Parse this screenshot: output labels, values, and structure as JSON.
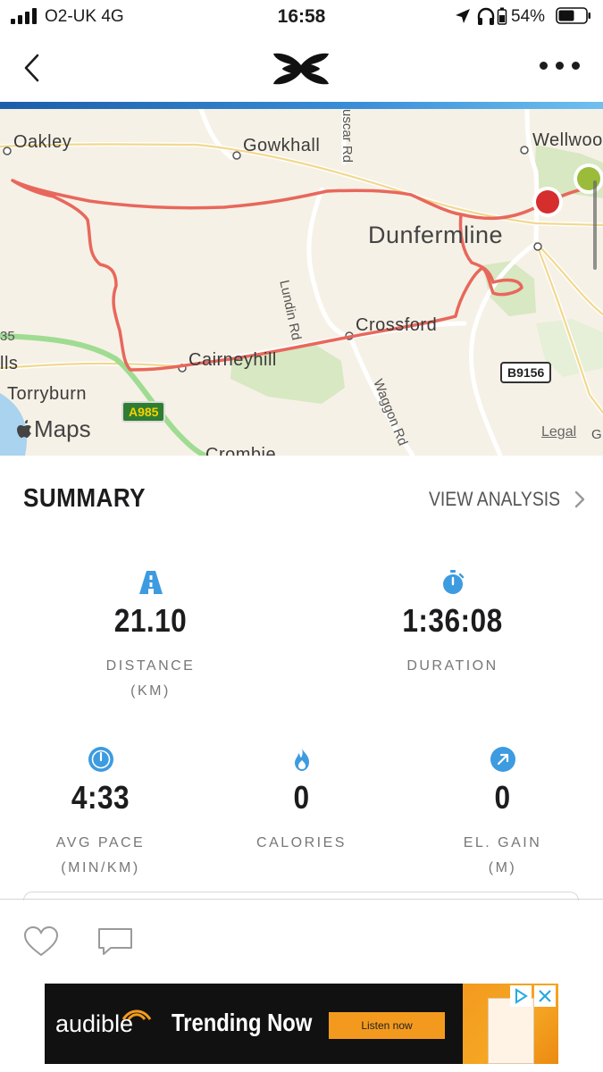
{
  "status_bar": {
    "carrier": "O2-UK  4G",
    "time": "16:58",
    "battery": "54%"
  },
  "header": {
    "back_icon": "chevron-left-icon",
    "logo": "under-armour-logo",
    "more_icon": "ellipsis-icon"
  },
  "map": {
    "places": {
      "oakley": "Oakley",
      "gowkhall": "Gowkhall",
      "wellwood": "Wellwoo",
      "dunfermline": "Dunfermline",
      "crossford": "Crossford",
      "cairneyhill": "Cairneyhill",
      "torryburn": "Torryburn",
      "lls": "lls",
      "num35": "35",
      "crombie": "Crombie",
      "edge_g": "G"
    },
    "roads": {
      "lundin": "Lundin Rd",
      "waggon": "Waggon Rd",
      "muscar": "uscar Rd",
      "a985": "A985",
      "b9156": "B9156"
    },
    "attribution": "Maps",
    "legal": "Legal",
    "route_color": "#e8675c",
    "start_color": "#9bbb3a",
    "end_color": "#d62d2d"
  },
  "summary": {
    "title": "SUMMARY",
    "view_analysis": "VIEW ANALYSIS",
    "stats": {
      "distance": {
        "value": "21.10",
        "label1": "DISTANCE",
        "label2": "(KM)",
        "icon": "road-icon"
      },
      "duration": {
        "value": "1:36:08",
        "label1": "DURATION",
        "icon": "stopwatch-icon"
      },
      "pace": {
        "value": "4:33",
        "label1": "AVG PACE",
        "label2": "(MIN/KM)",
        "icon": "speedometer-icon"
      },
      "calories": {
        "value": "0",
        "label1": "CALORIES",
        "icon": "flame-icon"
      },
      "elevation": {
        "value": "0",
        "label1": "EL. GAIN",
        "label2": "(M)",
        "icon": "arrow-up-right-icon"
      }
    },
    "accent_color": "#3d9be0"
  },
  "social": {
    "like_icon": "heart-icon",
    "comment_icon": "comment-icon"
  },
  "ad": {
    "brand": "audible",
    "headline": "Trending Now",
    "cta": "Listen now"
  }
}
